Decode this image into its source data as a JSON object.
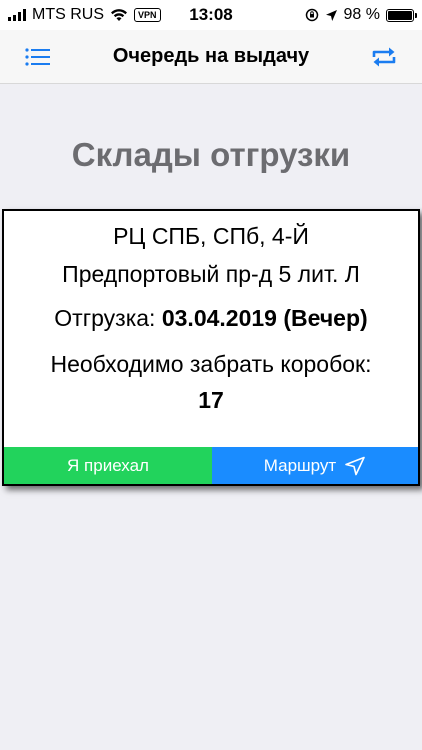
{
  "status_bar": {
    "carrier": "MTS RUS",
    "vpn": "VPN",
    "time": "13:08",
    "battery": "98 %",
    "battery_level": 0.98
  },
  "nav": {
    "title": "Очередь на выдачу",
    "menu_icon": "list-icon",
    "refresh_icon": "repeat-icon",
    "accent_color": "#1a7cf0"
  },
  "main": {
    "heading": "Склады отгрузки",
    "card": {
      "address_line1": "РЦ СПБ, СПб, 4-Й",
      "address_line2": "Предпортовый пр-д 5 лит. Л",
      "shipment_label": "Отгрузка:",
      "shipment_value": "03.04.2019 (Вечер)",
      "boxes_label": "Необходимо забрать коробок:",
      "boxes_count": "17",
      "arrived_button": "Я приехал",
      "route_button": "Маршрут",
      "route_icon": "navigation-arrow-icon",
      "arrived_color": "#22d35c",
      "route_color": "#1a8cff"
    }
  }
}
